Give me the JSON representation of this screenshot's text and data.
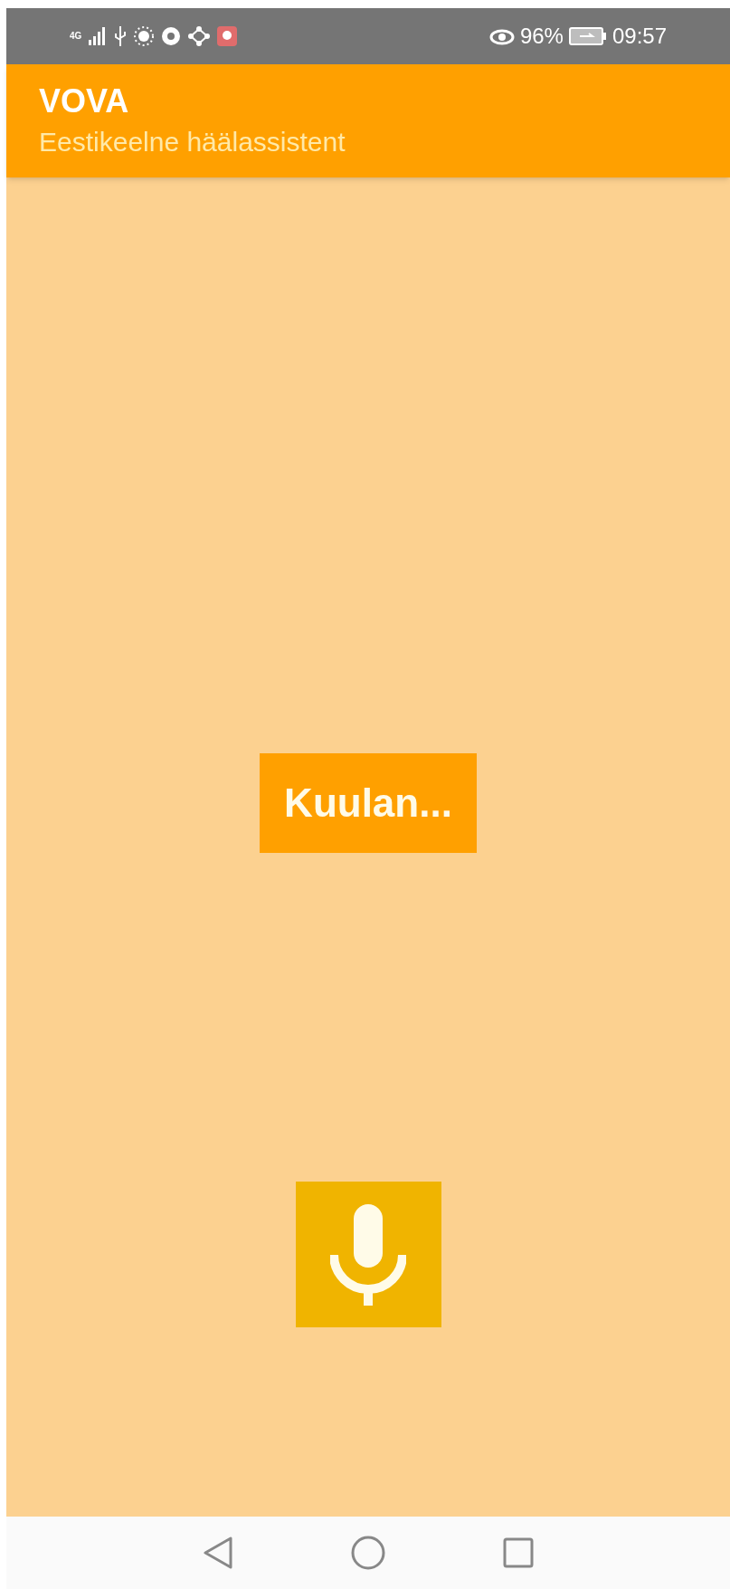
{
  "status_bar": {
    "network": "4G",
    "battery": "96%",
    "time": "09:57"
  },
  "app_bar": {
    "title": "VOVA",
    "subtitle": "Eestikeelne häälassistent"
  },
  "status_message": "Kuulan...",
  "mic_button": {
    "kind": "microphone"
  }
}
